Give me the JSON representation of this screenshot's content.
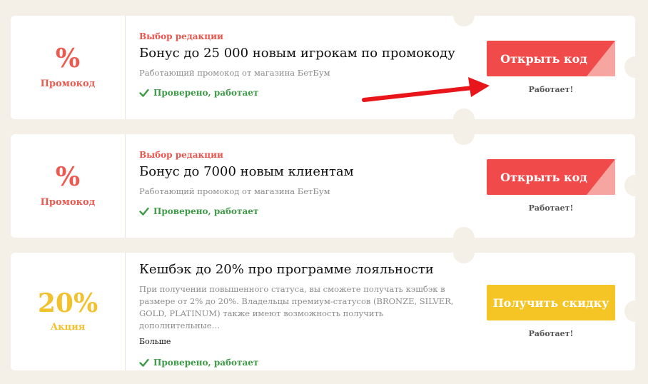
{
  "offers": [
    {
      "badge_symbol": "%",
      "badge_type": "Промокод",
      "editor_pick": "Выбор редакции",
      "title": "Бонус до 25 000 новым игрокам по промокоду",
      "description": "Работающий промокод от магазина БетБум",
      "verified": "Проверено, работает",
      "button_label": "Открыть код",
      "status": "Работает!",
      "accent": "#ec5a4f"
    },
    {
      "badge_symbol": "%",
      "badge_type": "Промокод",
      "editor_pick": "Выбор редакции",
      "title": "Бонус до 7000 новым клиентам",
      "description": "Работающий промокод от магазина БетБум",
      "verified": "Проверено, работает",
      "button_label": "Открыть код",
      "status": "Работает!",
      "accent": "#ec5a4f"
    },
    {
      "badge_symbol": "20%",
      "badge_type": "Акция",
      "title": "Кешбэк до 20% про программе лояльности",
      "description": "При получении повышенного статуса, вы сможете получать кэшбэк в размере от 2% до 20%. Владельцы премиум-статусов (BRONZE, SILVER, GOLD, PLATINUM) также имеют возможность получить дополнительные…",
      "more_label": "Больше",
      "verified": "Проверено, работает",
      "button_label": "Получить скидку",
      "status": "Работает!",
      "accent": "#f2c12e"
    }
  ],
  "colors": {
    "background": "#f4f0e8",
    "red_button": "#f04b4a",
    "yellow_button": "#f5c526",
    "verified_green": "#3d9a46",
    "annotation_arrow": "#e8161b"
  }
}
